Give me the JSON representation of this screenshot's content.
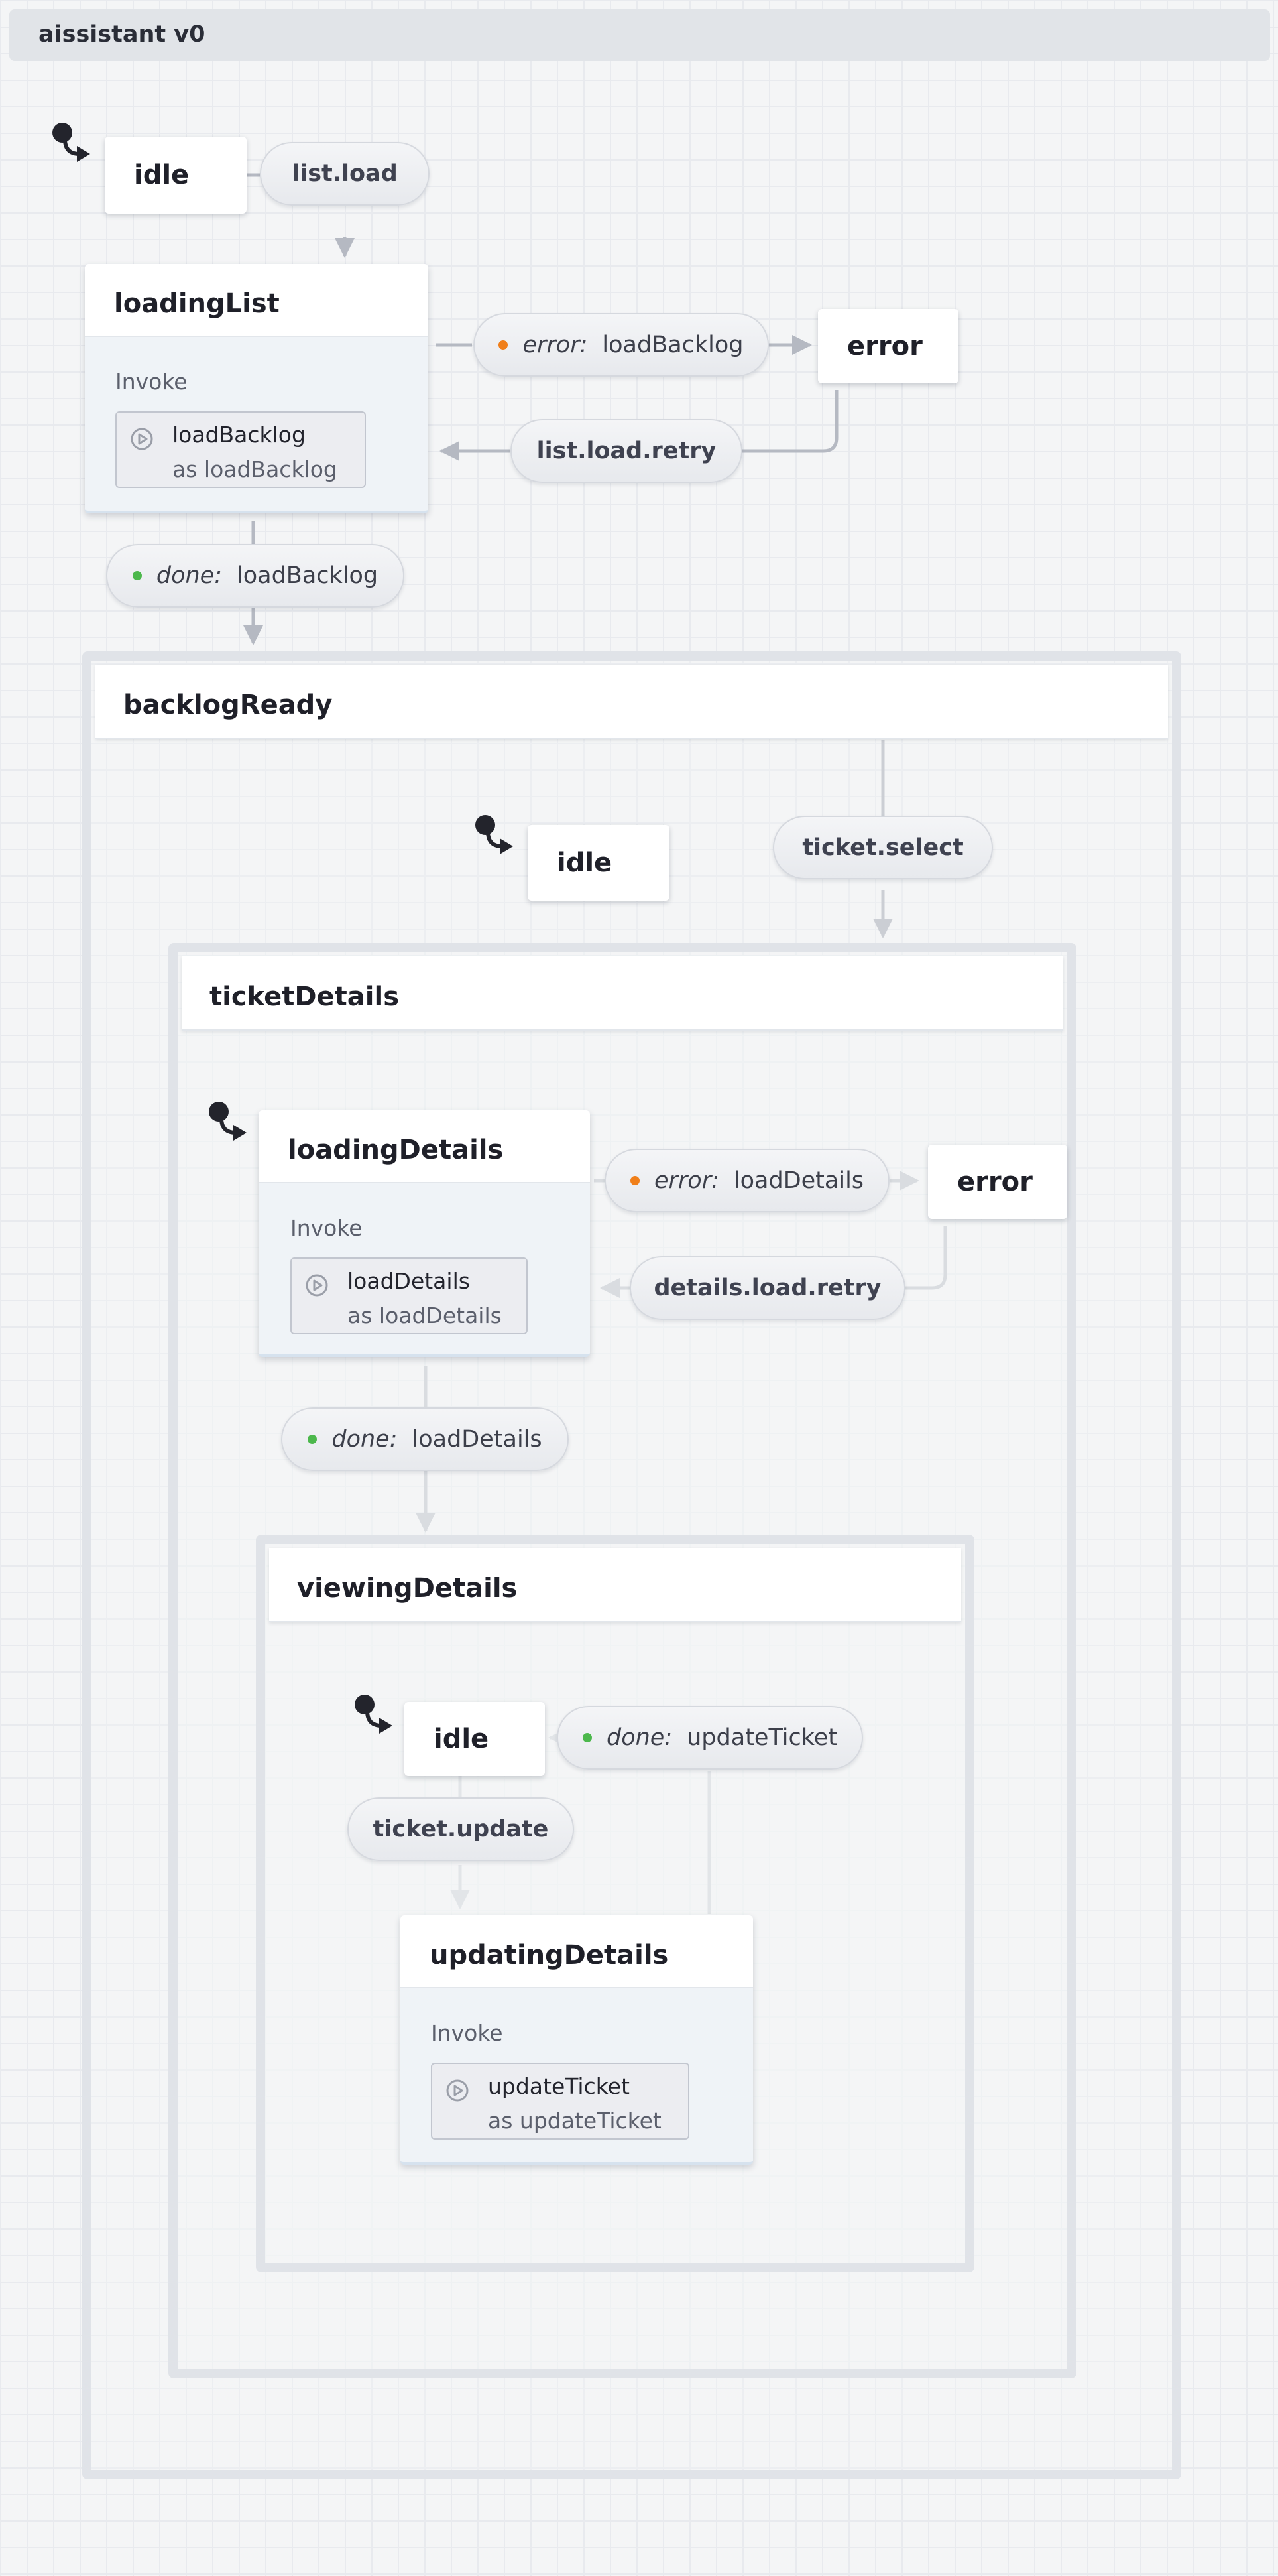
{
  "window": {
    "title": "aissistant v0"
  },
  "root": {
    "idle": "idle",
    "loadingList": {
      "title": "loadingList",
      "invoke_label": "Invoke",
      "service": "loadBacklog",
      "alias": "as loadBacklog"
    },
    "error": "error",
    "transitions": {
      "list_load": "list.load",
      "error_kind": "error:",
      "error_service": "loadBacklog",
      "retry": "list.load.retry",
      "done_kind": "done:",
      "done_service": "loadBacklog"
    },
    "backlogReady": {
      "title": "backlogReady",
      "idle": "idle",
      "ticket_select": "ticket.select",
      "ticketDetails": {
        "title": "ticketDetails",
        "loadingDetails": {
          "title": "loadingDetails",
          "invoke_label": "Invoke",
          "service": "loadDetails",
          "alias": "as loadDetails"
        },
        "error": "error",
        "error_kind": "error:",
        "error_service": "loadDetails",
        "retry": "details.load.retry",
        "done_kind": "done:",
        "done_service": "loadDetails",
        "viewingDetails": {
          "title": "viewingDetails",
          "idle": "idle",
          "done_kind": "done:",
          "done_service": "updateTicket",
          "ticket_update": "ticket.update",
          "updatingDetails": {
            "title": "updatingDetails",
            "invoke_label": "Invoke",
            "service": "updateTicket",
            "alias": "as updateTicket"
          }
        }
      }
    }
  },
  "colors": {
    "error_dot": "#f07f1a",
    "done_dot": "#4cb84c",
    "wire": "#b5b9c2",
    "group_border": "#e0e3e8"
  }
}
